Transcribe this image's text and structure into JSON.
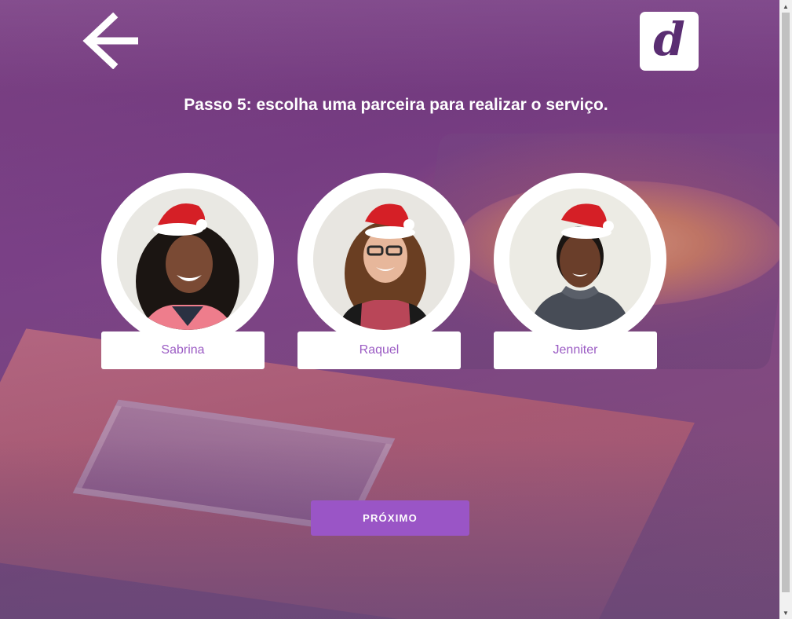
{
  "header": {
    "back_icon": "arrow-left-icon",
    "logo_letter": "d",
    "title": "Passo 5: escolha uma parceira para realizar o serviço."
  },
  "partners": [
    {
      "name": "Sabrina"
    },
    {
      "name": "Raquel"
    },
    {
      "name": "Jenniter"
    }
  ],
  "actions": {
    "next_label": "PRÓXIMO"
  },
  "colors": {
    "accent": "#9a55c6",
    "name_text": "#9b5cc4",
    "logo_letter": "#5a2d72"
  }
}
